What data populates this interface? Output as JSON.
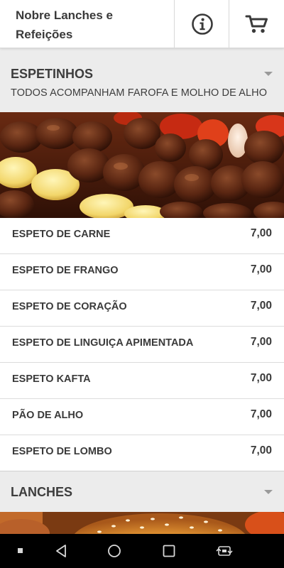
{
  "header": {
    "title": "Nobre Lanches e Refeições",
    "info_icon": "info-icon",
    "cart_icon": "cart-icon"
  },
  "sections": [
    {
      "title": "ESPETINHOS",
      "subtitle": "TODOS ACOMPANHAM FAROFA E MOLHO DE ALHO",
      "expanded": true,
      "items": [
        {
          "name": "ESPETO DE CARNE",
          "price": "7,00"
        },
        {
          "name": "ESPETO DE FRANGO",
          "price": "7,00"
        },
        {
          "name": "ESPETO DE CORAÇÃO",
          "price": "7,00"
        },
        {
          "name": "ESPETO DE LINGUIÇA APIMENTADA",
          "price": "7,00"
        },
        {
          "name": "ESPETO KAFTA",
          "price": "7,00"
        },
        {
          "name": "PÃO DE ALHO",
          "price": "7,00"
        },
        {
          "name": "ESPETO DE LOMBO",
          "price": "7,00"
        }
      ]
    },
    {
      "title": "LANCHES",
      "expanded": false
    }
  ],
  "navbar": {
    "icons": [
      "square-dot-icon",
      "back-icon",
      "home-icon",
      "recents-icon",
      "rotate-icon"
    ]
  },
  "colors": {
    "background": "#ececec",
    "card": "#ffffff",
    "text": "#3a3a3a"
  }
}
